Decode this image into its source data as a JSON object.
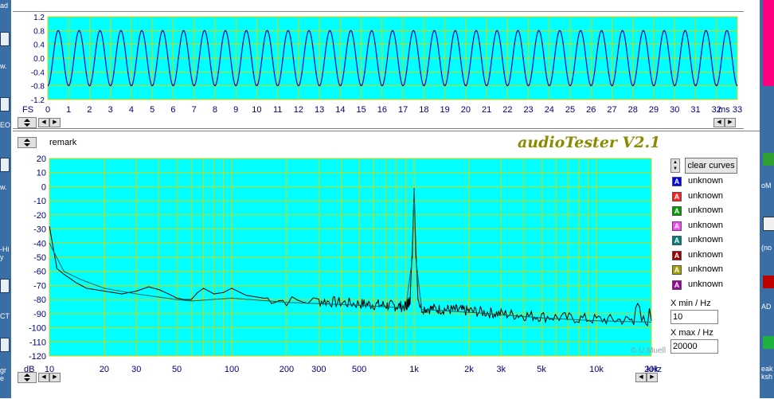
{
  "colors": {
    "plot_bg": "#00ffff",
    "grid": "#d4d400",
    "osc_line": "#0000cc",
    "spec_line": "#000000",
    "title": "#8b8b00",
    "axis_text": "#000080"
  },
  "desktop": {
    "left_labels": [
      "ad",
      "w.",
      "EO",
      "w.",
      "-Hi y",
      "CT",
      "gr e"
    ],
    "right_labels": [
      "oM",
      "(no",
      "AD",
      "eak ksh"
    ]
  },
  "oscilloscope": {
    "fs_label": "FS",
    "unit_label": "ms",
    "chart_data": {
      "type": "line",
      "y_ticks": [
        "1.2",
        "0.8",
        "0.4",
        "0.0",
        "-0.4",
        "-0.8",
        "-1.2"
      ],
      "ylim": [
        -1.2,
        1.2
      ],
      "x_ticks": [
        "0",
        "1",
        "2",
        "3",
        "4",
        "5",
        "6",
        "7",
        "8",
        "9",
        "10",
        "11",
        "12",
        "13",
        "14",
        "15",
        "16",
        "17",
        "18",
        "19",
        "20",
        "21",
        "22",
        "23",
        "24",
        "25",
        "26",
        "27",
        "28",
        "29",
        "30",
        "31",
        "32",
        "33"
      ],
      "xlim": [
        0,
        33
      ],
      "series": [
        {
          "amplitude": 0.8,
          "frequency_hz": 1000
        }
      ]
    }
  },
  "spectrum": {
    "remark_label": "remark",
    "title": "audioTester V2.1",
    "watermark": "© U.Mueller",
    "db_label": "dB",
    "khz_label": "kHz",
    "chart_data": {
      "type": "line",
      "x_scale": "log",
      "xlim": [
        10,
        20000
      ],
      "ylim": [
        -120,
        20
      ],
      "y_ticks": [
        "20",
        "10",
        "0",
        "-10",
        "-20",
        "-30",
        "-40",
        "-50",
        "-60",
        "-70",
        "-80",
        "-90",
        "-100",
        "-110",
        "-120"
      ],
      "x_ticks": [
        {
          "label": "10",
          "value": 10
        },
        {
          "label": "20",
          "value": 20
        },
        {
          "label": "30",
          "value": 30
        },
        {
          "label": "50",
          "value": 50
        },
        {
          "label": "100",
          "value": 100
        },
        {
          "label": "200",
          "value": 200
        },
        {
          "label": "300",
          "value": 300
        },
        {
          "label": "500",
          "value": 500
        },
        {
          "label": "1k",
          "value": 1000
        },
        {
          "label": "2k",
          "value": 2000
        },
        {
          "label": "3k",
          "value": 3000
        },
        {
          "label": "5k",
          "value": 5000
        },
        {
          "label": "10k",
          "value": 10000
        },
        {
          "label": "20k",
          "value": 20000
        }
      ],
      "series": [
        {
          "color": "#000000",
          "points": [
            [
              10,
              -28
            ],
            [
              11,
              -58
            ],
            [
              12,
              -62
            ],
            [
              14,
              -68
            ],
            [
              16,
              -72
            ],
            [
              20,
              -74
            ],
            [
              25,
              -76
            ],
            [
              30,
              -74
            ],
            [
              35,
              -71
            ],
            [
              40,
              -73
            ],
            [
              45,
              -76
            ],
            [
              50,
              -79
            ],
            [
              55,
              -80
            ],
            [
              60,
              -80
            ],
            [
              65,
              -75
            ],
            [
              70,
              -72
            ],
            [
              80,
              -76
            ],
            [
              90,
              -75
            ],
            [
              100,
              -72
            ],
            [
              120,
              -77
            ],
            [
              150,
              -79
            ],
            [
              200,
              -81
            ],
            [
              300,
              -81
            ],
            [
              500,
              -83
            ],
            [
              700,
              -84
            ],
            [
              900,
              -85
            ],
            [
              950,
              -80
            ],
            [
              980,
              -40
            ],
            [
              1000,
              -1
            ],
            [
              1020,
              -40
            ],
            [
              1050,
              -80
            ],
            [
              1100,
              -86
            ],
            [
              1500,
              -87
            ],
            [
              2000,
              -88
            ],
            [
              3000,
              -90
            ],
            [
              5000,
              -92
            ],
            [
              10000,
              -94
            ],
            [
              20000,
              -95
            ]
          ]
        },
        {
          "color": "#006464",
          "points": [
            [
              10,
              -40
            ],
            [
              12,
              -60
            ],
            [
              15,
              -66
            ],
            [
              20,
              -72
            ],
            [
              30,
              -76
            ],
            [
              50,
              -80
            ],
            [
              60,
              -81
            ],
            [
              100,
              -79
            ],
            [
              200,
              -82
            ],
            [
              500,
              -84
            ],
            [
              900,
              -86
            ],
            [
              980,
              -50
            ],
            [
              1000,
              -2
            ],
            [
              1020,
              -50
            ],
            [
              1100,
              -87
            ],
            [
              2000,
              -89
            ],
            [
              5000,
              -93
            ],
            [
              10000,
              -95
            ],
            [
              20000,
              -96
            ]
          ]
        }
      ]
    }
  },
  "curves": {
    "clear_label": "clear curves",
    "items": [
      {
        "letter": "A",
        "name": "unknown",
        "color": "#0000ff"
      },
      {
        "letter": "A",
        "name": "unknown",
        "color": "#ff2020"
      },
      {
        "letter": "A",
        "name": "unknown",
        "color": "#00a000"
      },
      {
        "letter": "A",
        "name": "unknown",
        "color": "#ff40ff"
      },
      {
        "letter": "A",
        "name": "unknown",
        "color": "#008080"
      },
      {
        "letter": "A",
        "name": "unknown",
        "color": "#a00000"
      },
      {
        "letter": "A",
        "name": "unknown",
        "color": "#a0a000"
      },
      {
        "letter": "A",
        "name": "unknown",
        "color": "#a000a0"
      }
    ]
  },
  "xrange": {
    "xmin_label": "X min / Hz",
    "xmin_value": "10",
    "xmax_label": "X max / Hz",
    "xmax_value": "20000"
  }
}
